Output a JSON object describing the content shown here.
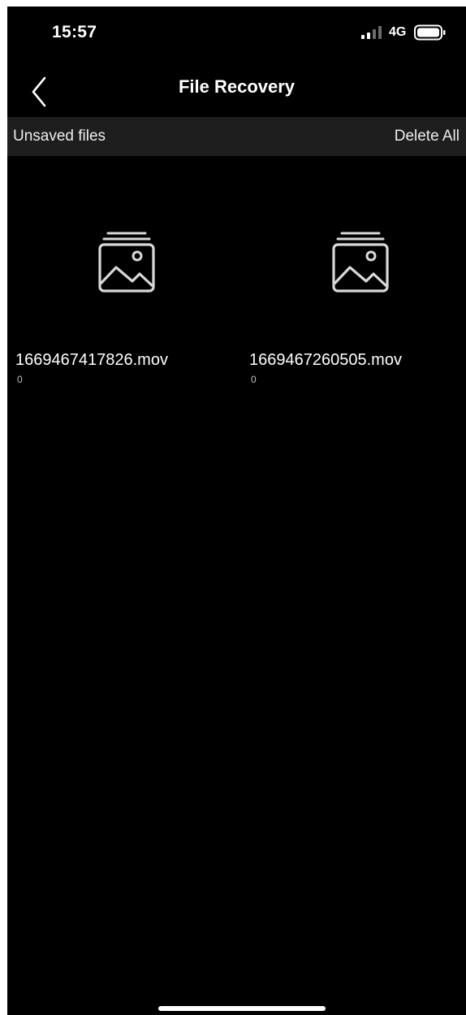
{
  "status_bar": {
    "time": "15:57",
    "network": "4G"
  },
  "nav": {
    "title": "File Recovery",
    "back_icon": "chevron-left-icon"
  },
  "section": {
    "title": "Unsaved files",
    "delete_all_label": "Delete All"
  },
  "files": [
    {
      "name": "1669467417826.mov",
      "size": "0",
      "icon": "image-stack-icon"
    },
    {
      "name": "1669467260505.mov",
      "size": "0",
      "icon": "image-stack-icon"
    }
  ],
  "colors": {
    "background": "#000000",
    "section_header": "#1e1e1e",
    "text": "#ffffff",
    "icon_stroke": "#d9d9d9"
  }
}
